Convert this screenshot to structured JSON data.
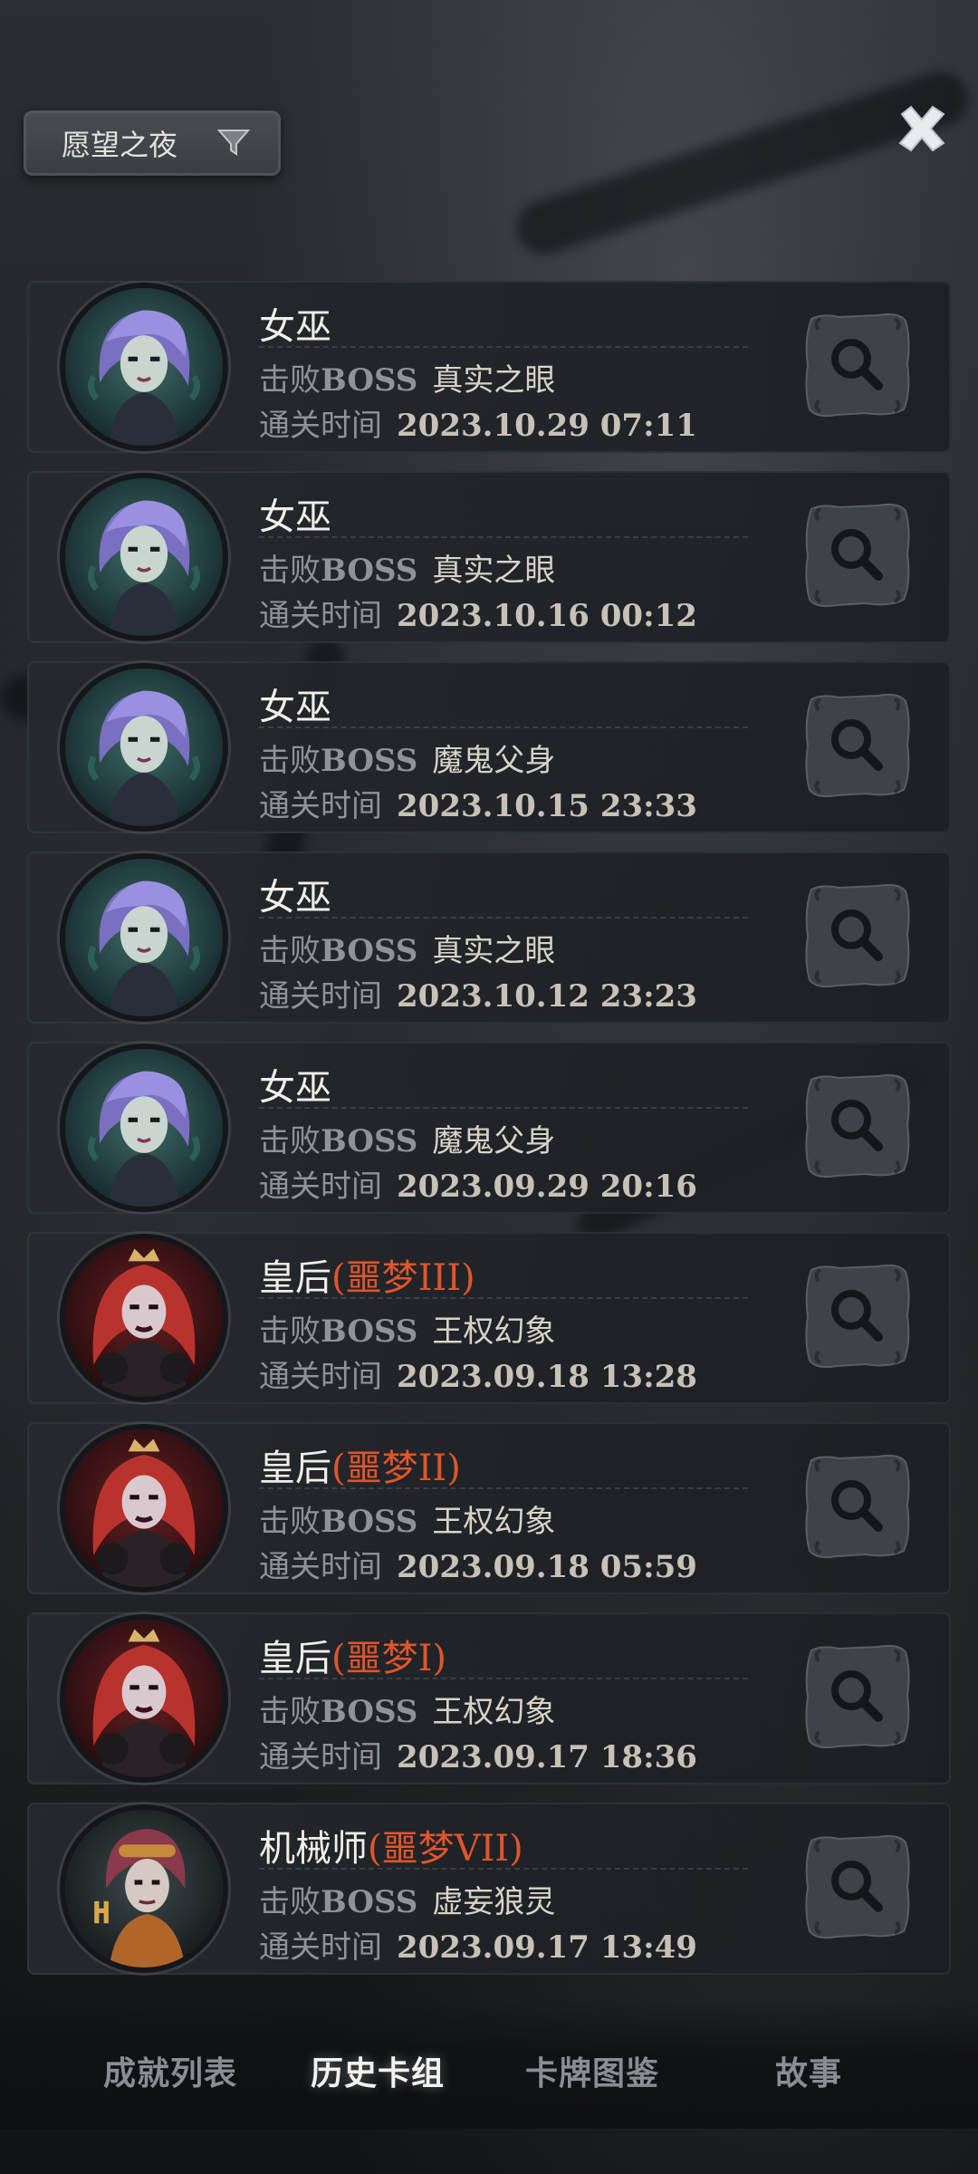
{
  "filter": {
    "label": "愿望之夜"
  },
  "records": [
    {
      "character": "女巫",
      "difficulty": "",
      "portrait": "witch",
      "boss_label": "击败",
      "boss_label_en": "BOSS",
      "boss": "真实之眼",
      "time_label": "通关时间",
      "time": "2023.10.29 07:11"
    },
    {
      "character": "女巫",
      "difficulty": "",
      "portrait": "witch",
      "boss_label": "击败",
      "boss_label_en": "BOSS",
      "boss": "真实之眼",
      "time_label": "通关时间",
      "time": "2023.10.16 00:12"
    },
    {
      "character": "女巫",
      "difficulty": "",
      "portrait": "witch",
      "boss_label": "击败",
      "boss_label_en": "BOSS",
      "boss": "魔鬼父身",
      "time_label": "通关时间",
      "time": "2023.10.15 23:33"
    },
    {
      "character": "女巫",
      "difficulty": "",
      "portrait": "witch",
      "boss_label": "击败",
      "boss_label_en": "BOSS",
      "boss": "真实之眼",
      "time_label": "通关时间",
      "time": "2023.10.12 23:23"
    },
    {
      "character": "女巫",
      "difficulty": "",
      "portrait": "witch",
      "boss_label": "击败",
      "boss_label_en": "BOSS",
      "boss": "魔鬼父身",
      "time_label": "通关时间",
      "time": "2023.09.29 20:16"
    },
    {
      "character": "皇后",
      "difficulty": "(噩梦III)",
      "portrait": "queen",
      "boss_label": "击败",
      "boss_label_en": "BOSS",
      "boss": "王权幻象",
      "time_label": "通关时间",
      "time": "2023.09.18 13:28"
    },
    {
      "character": "皇后",
      "difficulty": "(噩梦II)",
      "portrait": "queen",
      "boss_label": "击败",
      "boss_label_en": "BOSS",
      "boss": "王权幻象",
      "time_label": "通关时间",
      "time": "2023.09.18 05:59"
    },
    {
      "character": "皇后",
      "difficulty": "(噩梦I)",
      "portrait": "queen",
      "boss_label": "击败",
      "boss_label_en": "BOSS",
      "boss": "王权幻象",
      "time_label": "通关时间",
      "time": "2023.09.17 18:36"
    },
    {
      "character": "机械师",
      "difficulty": "(噩梦VII)",
      "portrait": "mechanic",
      "boss_label": "击败",
      "boss_label_en": "BOSS",
      "boss": "虚妄狼灵",
      "time_label": "通关时间",
      "time": "2023.09.17 13:49"
    }
  ],
  "tabs": [
    {
      "label": "成就列表",
      "active": false
    },
    {
      "label": "历史卡组",
      "active": true
    },
    {
      "label": "卡牌图鉴",
      "active": false
    },
    {
      "label": "故事",
      "active": false
    }
  ],
  "icons": {
    "filter": "funnel-icon",
    "close": "close-icon",
    "inspect": "magnifier-icon"
  },
  "colors": {
    "difficulty": "#e0552b",
    "active_tab": "#f4f2ee",
    "inactive_tab": "#8a8d92"
  }
}
